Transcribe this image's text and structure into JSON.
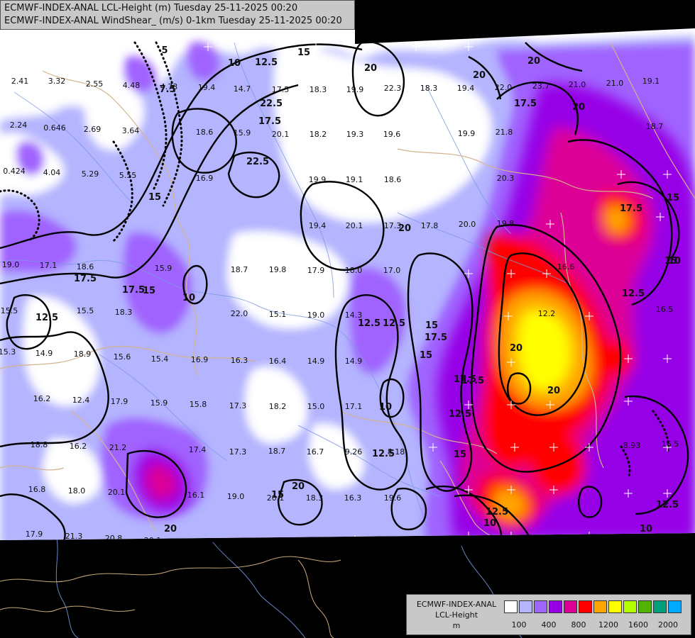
{
  "header": {
    "line1": "ECMWF-INDEX-ANAL LCL-Height (m) Tuesday 25-11-2025 00:20",
    "line2": "ECMWF-INDEX-ANAL WindShear_ (m/s) 0-1km Tuesday 25-11-2025 00:20"
  },
  "legend": {
    "title": "ECMWF-INDEX-ANAL",
    "variable": "LCL-Height",
    "unit": "m",
    "swatch_colors": [
      "#ffffff",
      "#b4b4ff",
      "#a064ff",
      "#9600e6",
      "#dc0096",
      "#ff0000",
      "#ffa500",
      "#ffff00",
      "#b4ff00",
      "#50b400",
      "#00a078",
      "#00aaff"
    ],
    "tick_labels": [
      "100",
      "400",
      "800",
      "1200",
      "1600",
      "2000"
    ]
  },
  "colors": {
    "background": "#000000",
    "no_data": "#000000",
    "contour": "#000000",
    "border": "#d2b48c",
    "river": "#7c9be0"
  },
  "point_values": [
    {
      "text": "2.41"
    },
    {
      "text": "3.32"
    },
    {
      "text": "2.55"
    },
    {
      "text": "4.48"
    },
    {
      "text": "4.73"
    },
    {
      "text": "19.4"
    },
    {
      "text": "14.7"
    },
    {
      "text": "17.5"
    },
    {
      "text": "18.3"
    },
    {
      "text": "19.9"
    },
    {
      "text": "22.3"
    },
    {
      "text": "18.3"
    },
    {
      "text": "19.4"
    },
    {
      "text": "22.0"
    },
    {
      "text": "23.7"
    },
    {
      "text": "21.0"
    },
    {
      "text": "21.0"
    },
    {
      "text": "19.1"
    },
    {
      "text": "2.24"
    },
    {
      "text": "0.646"
    },
    {
      "text": "2.69"
    },
    {
      "text": "3.64"
    },
    {
      "text": "18.6"
    },
    {
      "text": "15.9"
    },
    {
      "text": "20.1"
    },
    {
      "text": "18.2"
    },
    {
      "text": "19.3"
    },
    {
      "text": "19.6"
    },
    {
      "text": "19.9"
    },
    {
      "text": "21.8"
    },
    {
      "text": "18.7"
    },
    {
      "text": "0.424"
    },
    {
      "text": "4.04"
    },
    {
      "text": "5.29"
    },
    {
      "text": "5.55"
    },
    {
      "text": "16.9"
    },
    {
      "text": "19.9"
    },
    {
      "text": "19.1"
    },
    {
      "text": "18.6"
    },
    {
      "text": "20.3"
    },
    {
      "text": "19.4"
    },
    {
      "text": "20.1"
    },
    {
      "text": "17.3"
    },
    {
      "text": "17.8"
    },
    {
      "text": "20.0"
    },
    {
      "text": "19.8"
    },
    {
      "text": "19.0"
    },
    {
      "text": "17.1"
    },
    {
      "text": "18.6"
    },
    {
      "text": "15.9"
    },
    {
      "text": "18.7"
    },
    {
      "text": "19.8"
    },
    {
      "text": "17.9"
    },
    {
      "text": "18.0"
    },
    {
      "text": "17.0"
    },
    {
      "text": "16.6"
    },
    {
      "text": "15.5"
    },
    {
      "text": "15.5"
    },
    {
      "text": "18.3"
    },
    {
      "text": "22.0"
    },
    {
      "text": "15.1"
    },
    {
      "text": "19.0"
    },
    {
      "text": "14.3"
    },
    {
      "text": "12.2"
    },
    {
      "text": "16.5"
    },
    {
      "text": "15.3"
    },
    {
      "text": "14.9"
    },
    {
      "text": "18.9"
    },
    {
      "text": "15.6"
    },
    {
      "text": "15.4"
    },
    {
      "text": "16.9"
    },
    {
      "text": "16.3"
    },
    {
      "text": "16.4"
    },
    {
      "text": "14.9"
    },
    {
      "text": "14.9"
    },
    {
      "text": "16.2"
    },
    {
      "text": "12.4"
    },
    {
      "text": "17.9"
    },
    {
      "text": "15.9"
    },
    {
      "text": "15.8"
    },
    {
      "text": "17.3"
    },
    {
      "text": "18.2"
    },
    {
      "text": "15.0"
    },
    {
      "text": "17.1"
    },
    {
      "text": "18.8"
    },
    {
      "text": "16.2"
    },
    {
      "text": "21.2"
    },
    {
      "text": "17.4"
    },
    {
      "text": "17.3"
    },
    {
      "text": "18.7"
    },
    {
      "text": "16.7"
    },
    {
      "text": "9.26"
    },
    {
      "text": "8.18"
    },
    {
      "text": "8.93"
    },
    {
      "text": "16.5"
    },
    {
      "text": "16.8"
    },
    {
      "text": "18.0"
    },
    {
      "text": "20.1"
    },
    {
      "text": "16.1"
    },
    {
      "text": "19.0"
    },
    {
      "text": "20.1"
    },
    {
      "text": "18.3"
    },
    {
      "text": "16.3"
    },
    {
      "text": "19.6"
    },
    {
      "text": "17.9"
    },
    {
      "text": "21.3"
    },
    {
      "text": "20.8"
    },
    {
      "text": "20.1"
    },
    {
      "text": "17.8"
    },
    {
      "text": "19.5"
    },
    {
      "text": "14.9"
    }
  ],
  "contour_labels": [
    {
      "text": "15"
    },
    {
      "text": "12.5"
    },
    {
      "text": "10"
    },
    {
      "text": "20"
    },
    {
      "text": "22.5"
    },
    {
      "text": "17.5"
    },
    {
      "text": "7.5"
    },
    {
      "text": "5"
    },
    {
      "text": "22.5"
    },
    {
      "text": "20"
    },
    {
      "text": "20"
    },
    {
      "text": "17.5"
    },
    {
      "text": "15"
    },
    {
      "text": "12.5"
    },
    {
      "text": "17.5"
    },
    {
      "text": "15"
    },
    {
      "text": "17.5"
    },
    {
      "text": "10"
    },
    {
      "text": "12.5"
    },
    {
      "text": "12.5"
    },
    {
      "text": "15"
    },
    {
      "text": "17.5"
    },
    {
      "text": "15"
    },
    {
      "text": "10"
    },
    {
      "text": "12.5"
    },
    {
      "text": "17.5"
    },
    {
      "text": "12.5"
    },
    {
      "text": "20"
    },
    {
      "text": "15"
    },
    {
      "text": "20"
    },
    {
      "text": "17.5"
    },
    {
      "text": "20"
    },
    {
      "text": "15"
    },
    {
      "text": "17.5"
    },
    {
      "text": "15"
    },
    {
      "text": "12.5"
    },
    {
      "text": "10"
    },
    {
      "text": "12.5"
    },
    {
      "text": "20"
    },
    {
      "text": "20"
    },
    {
      "text": "15"
    },
    {
      "text": "10"
    },
    {
      "text": "12.5"
    },
    {
      "text": "10"
    },
    {
      "text": "20"
    }
  ]
}
